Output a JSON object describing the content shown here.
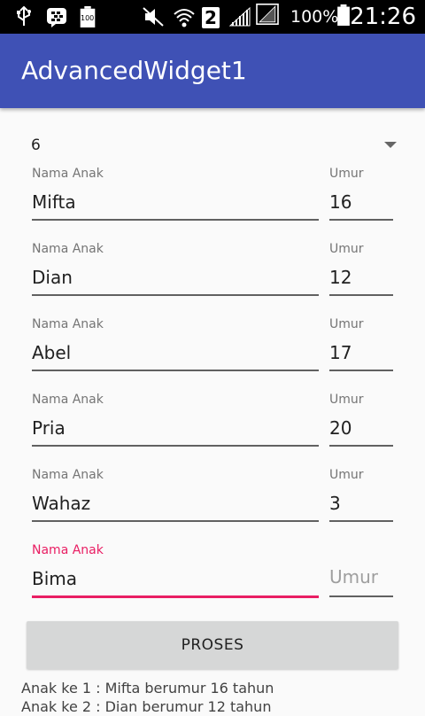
{
  "status_bar": {
    "battery_percent": "100%",
    "time": "21:26",
    "sim_badge": "2",
    "battery_small_label": "100"
  },
  "app_bar": {
    "title": "AdvancedWidget1"
  },
  "spinner": {
    "selected": "6"
  },
  "form": {
    "rows": [
      {
        "name_label": "Nama Anak",
        "name_value": "Mifta",
        "age_label": "Umur",
        "age_value": "16"
      },
      {
        "name_label": "Nama Anak",
        "name_value": "Dian",
        "age_label": "Umur",
        "age_value": "12"
      },
      {
        "name_label": "Nama Anak",
        "name_value": "Abel",
        "age_label": "Umur",
        "age_value": "17"
      },
      {
        "name_label": "Nama Anak",
        "name_value": "Pria",
        "age_label": "Umur",
        "age_value": "20"
      },
      {
        "name_label": "Nama Anak",
        "name_value": "Wahaz",
        "age_label": "Umur",
        "age_value": "3"
      },
      {
        "name_label": "Nama Anak",
        "name_value": "Bima",
        "age_placeholder": "Umur"
      }
    ],
    "focus_color": "#e91e63"
  },
  "button": {
    "label": "PROSES"
  },
  "results": [
    "Anak ke 1 : Mifta berumur 16 tahun",
    "Anak ke 2 : Dian berumur 12 tahun"
  ],
  "colors": {
    "primary": "#3f51b5",
    "accent": "#e91e63"
  }
}
